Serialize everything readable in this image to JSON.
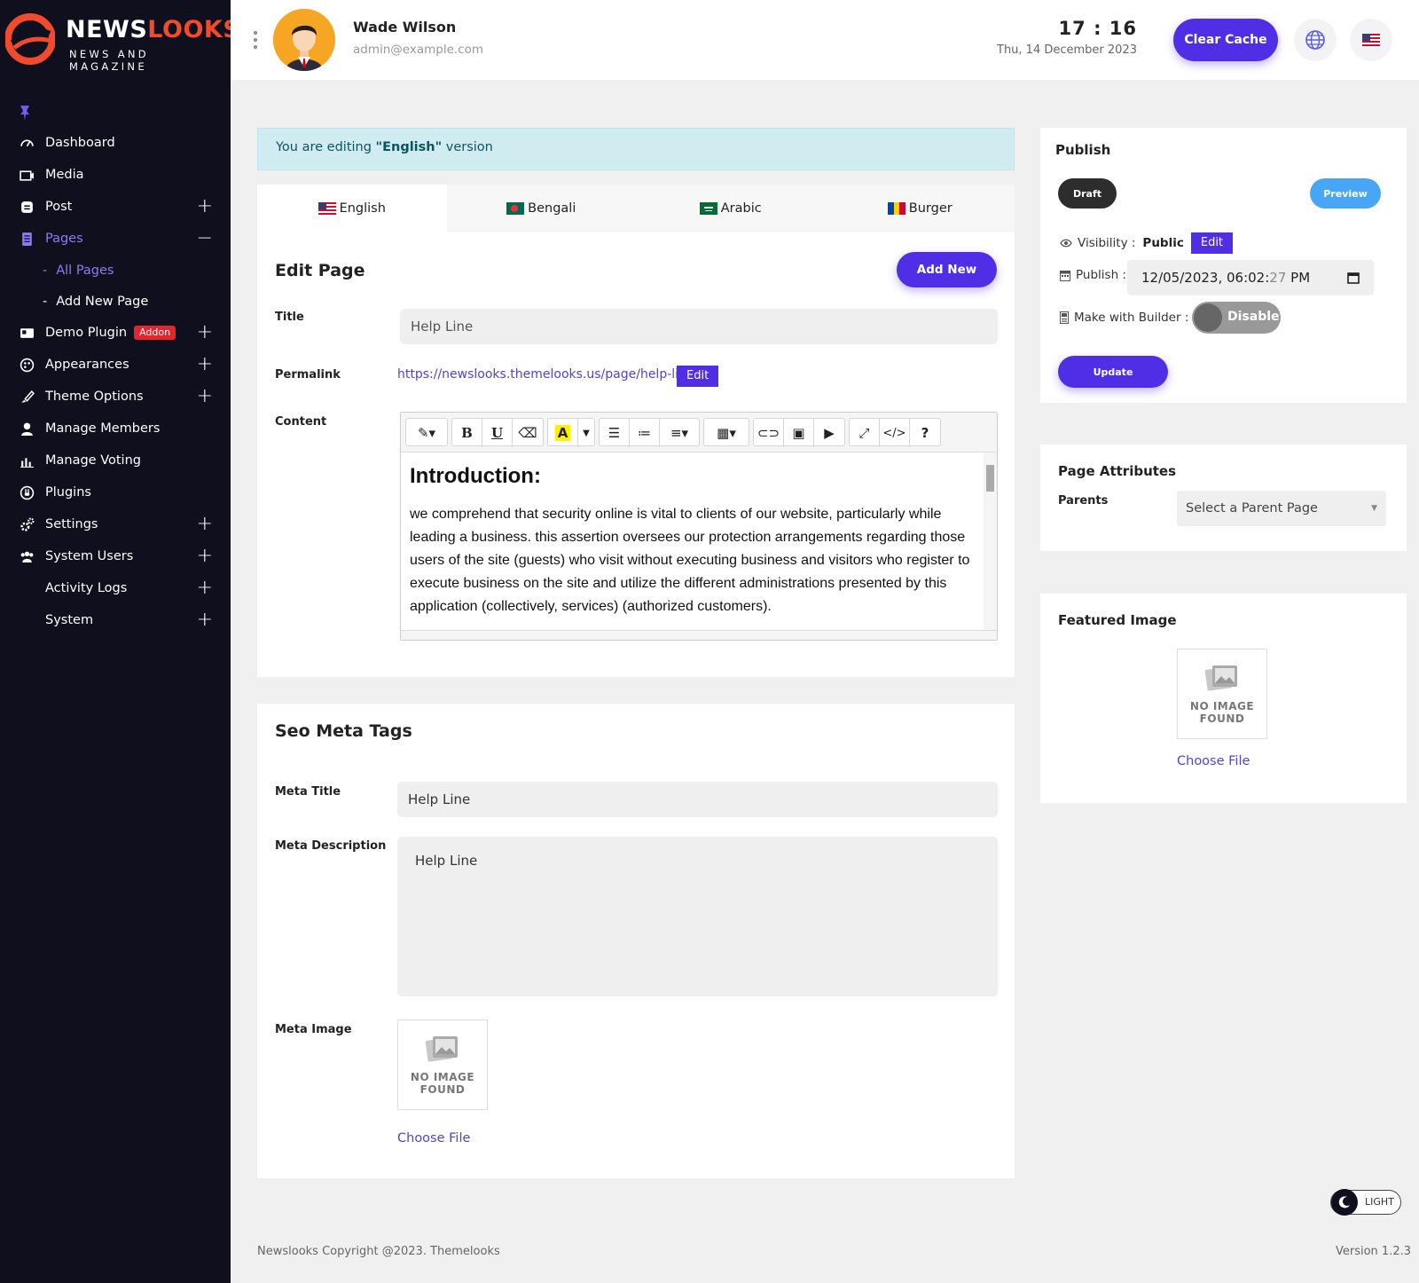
{
  "brand": {
    "name_part1": "NEWS",
    "name_part2": "LOOKS",
    "tagline": "NEWS AND MAGAZINE"
  },
  "header": {
    "user_name": "Wade Wilson",
    "user_email": "admin@example.com",
    "time": "17 : 16",
    "date": "Thu, 14 December 2023",
    "clear_cache": "Clear Cache"
  },
  "sidebar": {
    "items": [
      {
        "label": "Dashboard"
      },
      {
        "label": "Media"
      },
      {
        "label": "Post"
      },
      {
        "label": "Pages"
      },
      {
        "label": "Demo Plugin",
        "badge": "Addon"
      },
      {
        "label": "Appearances"
      },
      {
        "label": "Theme Options"
      },
      {
        "label": "Manage Members"
      },
      {
        "label": "Manage Voting"
      },
      {
        "label": "Plugins"
      },
      {
        "label": "Settings"
      },
      {
        "label": "System Users"
      },
      {
        "label": "Activity Logs"
      },
      {
        "label": "System"
      }
    ],
    "pages_sub": [
      {
        "label": "All Pages"
      },
      {
        "label": "Add New Page"
      }
    ]
  },
  "notice": {
    "prefix": "You are editing ",
    "lang": "\"English\"",
    "suffix": " version"
  },
  "tabs": [
    {
      "label": "English"
    },
    {
      "label": "Bengali"
    },
    {
      "label": "Arabic"
    },
    {
      "label": "Burger"
    }
  ],
  "edit": {
    "title": "Edit Page",
    "add_new": "Add New",
    "title_label": "Title",
    "title_value": "Help Line",
    "permalink_label": "Permalink",
    "permalink": "https://newslooks.themelooks.us/page/help-line",
    "edit_btn": "Edit",
    "content_label": "Content",
    "content_heading": "Introduction:",
    "content_text": "we comprehend that security online is vital to clients of our website, particularly while leading a business. this assertion oversees our protection arrangements regarding those users of the site (guests) who visit without executing business and visitors who register to execute business on the site and utilize the different administrations presented by this application (collectively, services) (authorized customers)."
  },
  "seo": {
    "title": "Seo Meta Tags",
    "meta_title_label": "Meta Title",
    "meta_title_value": "Help Line",
    "meta_desc_label": "Meta Description",
    "meta_desc_value": "Help Line",
    "meta_image_label": "Meta Image",
    "no_image": "NO IMAGE FOUND",
    "choose_file": "Choose File"
  },
  "publish": {
    "title": "Publish",
    "draft": "Draft",
    "preview": "Preview",
    "visibility_label": "Visibility :",
    "visibility_value": "Public",
    "edit": "Edit",
    "publish_label": "Publish :",
    "publish_date": "12/05/2023, 06:02:",
    "publish_date_sec": "27",
    "publish_date_ampm": " PM",
    "builder_label": "Make with Builder :",
    "builder_toggle": "Disable",
    "update": "Update"
  },
  "attributes": {
    "title": "Page Attributes",
    "parents_label": "Parents",
    "parents_placeholder": "Select a Parent Page"
  },
  "featured": {
    "title": "Featured Image",
    "no_image": "NO IMAGE FOUND",
    "choose_file": "Choose File"
  },
  "footer": {
    "copyright": "Newslooks Copyright @2023. Themelooks",
    "version": "Version 1.2.3",
    "theme_toggle": "LIGHT"
  },
  "colors": {
    "accent": "#4f2ee6",
    "sidebar_bg": "#0f0f1e",
    "brand_orange": "#f24a2c",
    "preview_blue": "#49a6f7"
  }
}
